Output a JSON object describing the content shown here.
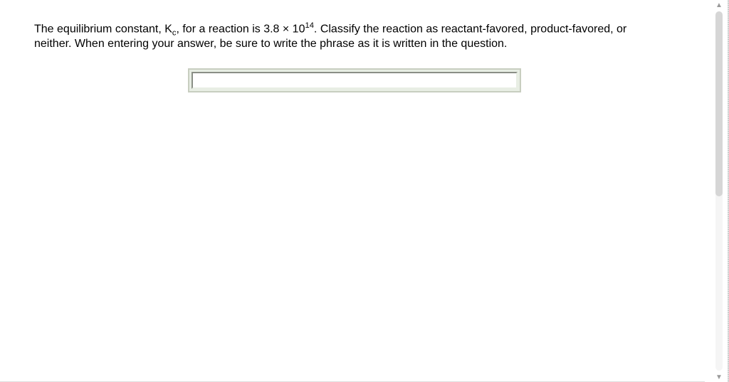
{
  "question": {
    "part1": "The equilibrium constant, K",
    "sub1": "c",
    "part2": ", for a reaction is 3.8 × 10",
    "sup1": "14",
    "part3": ".  Classify the reaction as reactant-favored, product-favored, or neither. When entering your answer, be sure to write the phrase as it is written in the question."
  },
  "input": {
    "value": "",
    "placeholder": ""
  },
  "scrollbar": {
    "up_glyph": "▲",
    "down_glyph": "▼"
  }
}
